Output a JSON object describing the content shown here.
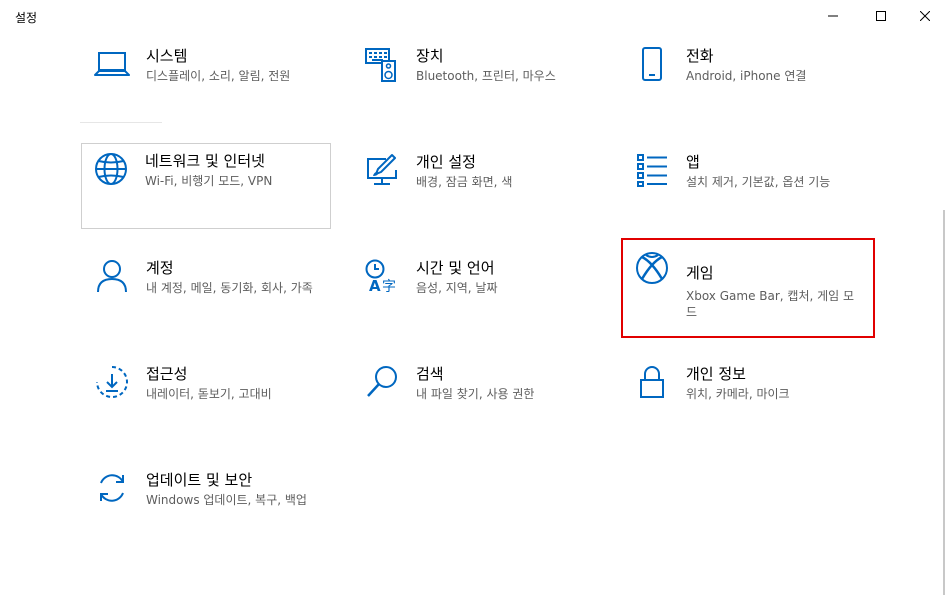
{
  "window": {
    "title": "설정",
    "buttons": {
      "minimize": "minimize-icon",
      "maximize": "maximize-icon",
      "close": "close-icon"
    }
  },
  "colors": {
    "accent": "#0067c0",
    "highlight": "#e10000",
    "description": "#5d5d5d"
  },
  "tiles": [
    {
      "name": "시스템",
      "description": "디스플레이, 소리, 알림, 전원",
      "icon": "laptop-icon"
    },
    {
      "name": "장치",
      "description": "Bluetooth, 프린터, 마우스",
      "icon": "keyboard-speaker-icon"
    },
    {
      "name": "전화",
      "description": "Android, iPhone 연결",
      "icon": "phone-icon"
    },
    {
      "name": "네트워크 및 인터넷",
      "description": "Wi-Fi, 비행기 모드, VPN",
      "icon": "globe-icon"
    },
    {
      "name": "개인 설정",
      "description": "배경, 잠금 화면, 색",
      "icon": "personalization-icon"
    },
    {
      "name": "앱",
      "description": "설치 제거, 기본값, 옵션 기능",
      "icon": "apps-list-icon"
    },
    {
      "name": "계정",
      "description": "내 계정, 메일, 동기화, 회사, 가족",
      "icon": "person-icon"
    },
    {
      "name": "시간 및 언어",
      "description": "음성, 지역, 날짜",
      "icon": "time-language-icon"
    },
    {
      "name": "게임",
      "description": "Xbox Game Bar, 캡처, 게임 모드",
      "icon": "xbox-icon"
    },
    {
      "name": "접근성",
      "description": "내레이터, 돋보기, 고대비",
      "icon": "accessibility-icon"
    },
    {
      "name": "검색",
      "description": "내 파일 찾기, 사용 권한",
      "icon": "search-icon"
    },
    {
      "name": "개인 정보",
      "description": "위치, 카메라, 마이크",
      "icon": "lock-icon"
    },
    {
      "name": "업데이트 및 보안",
      "description": "Windows 업데이트, 복구, 백업",
      "icon": "update-icon"
    }
  ]
}
